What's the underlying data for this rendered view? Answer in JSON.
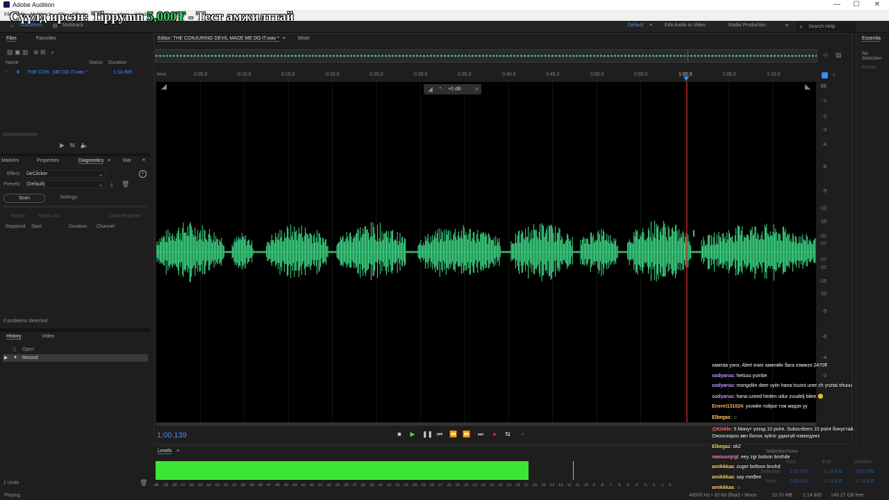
{
  "window": {
    "app_title": "Adobe Audition",
    "minimize": "—",
    "maximize": "☐",
    "close": "✕"
  },
  "overlay": {
    "text_prefix": "Сүүлд ирсэн: Tippymn ",
    "amount": "5,000₮",
    "text_suffix": " - Тест амжилттай"
  },
  "menubar": {
    "items": [
      "File",
      "Edit",
      "Multitrack",
      "Clip",
      "Effects",
      "Favorites",
      "View",
      "Window",
      "Help"
    ]
  },
  "toolbar": {
    "waveform": "Waveform",
    "multitrack": "Multitrack",
    "workspace_default": "Default",
    "edit_audio_to_video": "Edit Audio to Video",
    "radio_production": "Radio Production",
    "search_placeholder": "Search Help"
  },
  "files_panel": {
    "tabs": [
      "Files",
      "Favorites"
    ],
    "columns": [
      "Name",
      "Status",
      "Duration"
    ],
    "rows": [
      {
        "name": "THE CON...ME DO IT.wav *",
        "duration": "1:14.805"
      }
    ]
  },
  "diagnostics_panel": {
    "tabs": [
      "Markers",
      "Properties",
      "Diagnostics",
      "Mat"
    ],
    "effect_label": "Effect:",
    "effect_value": "DeClicker",
    "presets_label": "Presets:",
    "presets_value": "(Default)",
    "scan": "Scan",
    "settings": "Settings",
    "repair": "Repair",
    "repair_all": "Repair All",
    "clear_repaired": "Clear Repaired",
    "columns": [
      "Repaired",
      "Start",
      "Duration",
      "Channel"
    ],
    "status": "0 problems detected."
  },
  "history_panel": {
    "tabs": [
      "History",
      "Video"
    ],
    "items": [
      "Open",
      "Record"
    ],
    "undo_count": "1 Undo"
  },
  "editor": {
    "tab_title": "Editor: THE CONJURING DEVIL MADE ME DO IT.wav *",
    "mixer_tab": "Mixer",
    "gain": "+0 dB",
    "time_ruler": [
      "hms",
      "0:05.0",
      "0:10.0",
      "0:15.0",
      "0:20.0",
      "0:25.0",
      "0:30.0",
      "0:35.0",
      "0:40.0",
      "0:45.0",
      "0:50.0",
      "0:55.0",
      "1:00.0",
      "1:05.0",
      "1:10.0"
    ],
    "db_scale": [
      "dB",
      "-1",
      "-2",
      "-3",
      "-4",
      "-6",
      "-9",
      "-12",
      "-15",
      "-21",
      "-27",
      "-27",
      "-21",
      "-15",
      "-12",
      "-9",
      "-6",
      "-4",
      "-3"
    ],
    "current_time": "1:00.139"
  },
  "right_panel": {
    "title": "Essentia",
    "no_selection": "No Selection",
    "preset": "Preset"
  },
  "selection_view": {
    "title": "Selection/View",
    "headers": [
      "Start",
      "End",
      "Duration"
    ],
    "selection_label": "Selection",
    "selection": [
      "1:00.000",
      "1:14.805",
      "0:00.000"
    ],
    "view_label": "View",
    "view": [
      "0:00.000",
      "1:14.805",
      "1:14.805"
    ]
  },
  "levels": {
    "title": "Levels",
    "ticks": [
      "dB",
      "-59",
      "-58",
      "-57",
      "-56",
      "-55",
      "-54",
      "-53",
      "-52",
      "-51",
      "-50",
      "-49",
      "-48",
      "-47",
      "-46",
      "-45",
      "-44",
      "-43",
      "-42",
      "-41",
      "-40",
      "-39",
      "-38",
      "-37",
      "-36",
      "-35",
      "-34",
      "-33",
      "-32",
      "-31",
      "-30",
      "-29",
      "-28",
      "-27",
      "-26",
      "-25",
      "-24",
      "-23",
      "-22",
      "-21",
      "-20",
      "-19",
      "-18",
      "-17",
      "-16",
      "-15",
      "-14",
      "-13",
      "-12",
      "-11",
      "-10",
      "-9",
      "-8",
      "-7",
      "-6",
      "-5",
      "-4",
      "-3",
      "-2",
      "-1",
      "0"
    ]
  },
  "statusbar": {
    "playing": "Playing",
    "format": "48000 Hz • 32-bit (float) • Mono",
    "size": "13.70 MB",
    "duration": "1:14.805",
    "free": "149.27 GB free"
  },
  "chat": [
    {
      "user": "",
      "msg": "хамтаа уэнэ, Alert очих хамгийн бага хэмжээ 2470₮",
      "color": "#ffffff"
    },
    {
      "user": "sodyaruu",
      "msg": ": hetsuu yumbe",
      "color": "#c89cff"
    },
    {
      "user": "sodyaruu",
      "msg": ": mongoliin deer uyiin hana tsusni uner ch ynztai shuuu",
      "color": "#c89cff"
    },
    {
      "user": "sodyaruu",
      "msg": ": hana uzeed heden udur zuudelj bilee 😊",
      "color": "#c89cff"
    },
    {
      "user": "Enerel131024",
      "msg": ": ухлийн тойрог гэж мэдэх уу",
      "color": "#ffb36b"
    },
    {
      "user": "Elbegaz",
      "msg": ":",
      "color": "#ffd36b"
    },
    {
      "user": "@Klekle",
      "msg": ": 5 Минут үзээд 10 point. Subscribers 10 point бонустай.",
      "color": "#ff7a7a"
    },
    {
      "user": "",
      "msg": "Оноогоороо авч болох зүйлс удахгүй нэмэгдэнэ",
      "color": "#ffffff"
    },
    {
      "user": "Elbegaz",
      "msg": ": ok2",
      "color": "#ffd36b"
    },
    {
      "user": "namuunjrgl",
      "msg": ": eey zgr bolson bnshde",
      "color": "#ff8cc8"
    },
    {
      "user": "amikkkaa",
      "msg": ": zuger boltson bnshd",
      "color": "#ffd36b"
    },
    {
      "user": "amikkkaa",
      "msg": ": say medlee",
      "color": "#ffd36b"
    },
    {
      "user": "amikkkaa",
      "msg": ":",
      "color": "#ffd36b"
    }
  ],
  "colors": {
    "waveform": "#3fe08a",
    "playhead": "#c81e1e",
    "accent": "#3a8cff",
    "levels": "#3ce636"
  }
}
